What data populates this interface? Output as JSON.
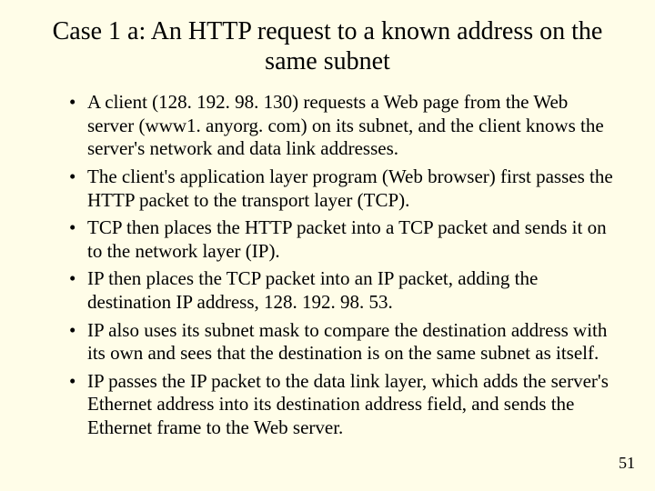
{
  "title": "Case 1 a: An HTTP request to a known address on the same subnet",
  "bullets": [
    "A client (128. 192. 98. 130) requests a Web page from the Web server (www1. anyorg. com) on its subnet, and the client knows the server's network and data link addresses.",
    "The client's application layer program (Web browser) first passes the HTTP packet to the transport layer (TCP).",
    "TCP then places the HTTP packet into a TCP packet and sends it on to the network layer (IP).",
    "IP then places the TCP packet into an IP packet, adding the destination IP address, 128. 192. 98. 53.",
    "IP also uses its subnet mask to compare the destination address with its own and sees that the destination is on the same subnet as itself.",
    "IP passes the IP packet to the data link layer, which adds the server's Ethernet address into its destination address field, and sends the Ethernet frame to the Web server."
  ],
  "page_number": "51"
}
